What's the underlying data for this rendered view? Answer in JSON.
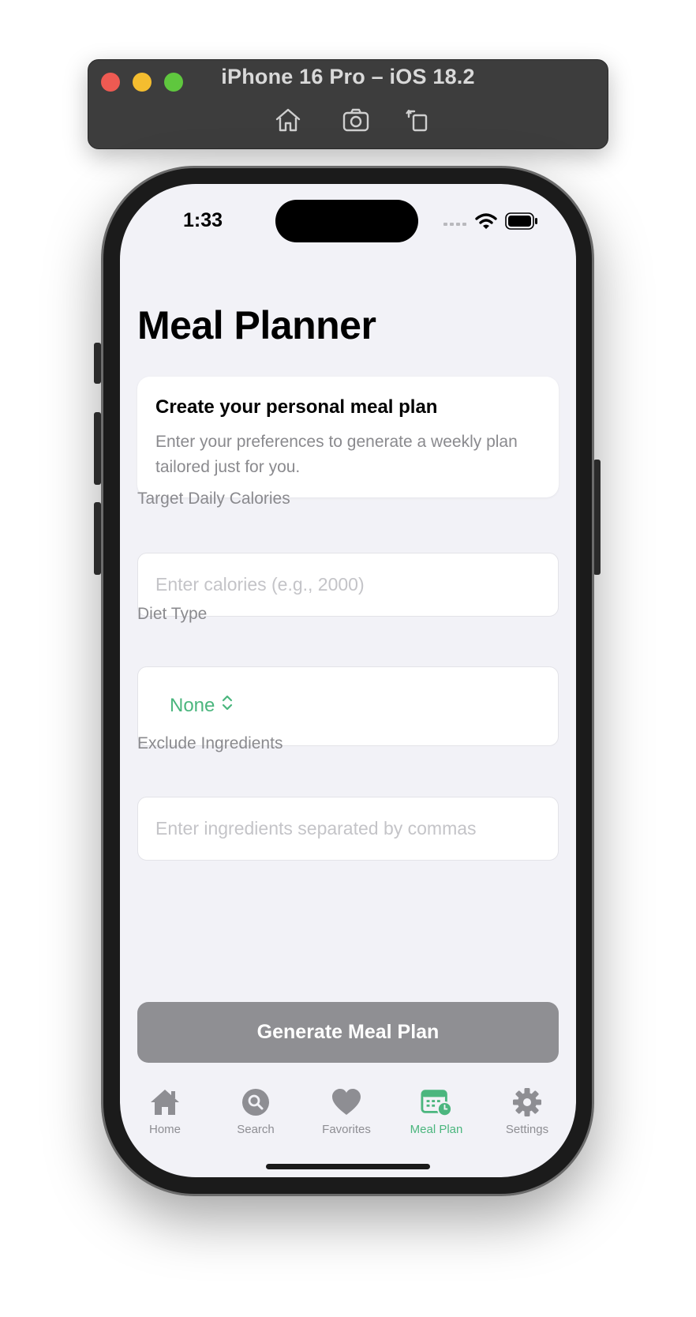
{
  "simulator": {
    "title": "iPhone 16 Pro – iOS 18.2"
  },
  "status_bar": {
    "time": "1:33"
  },
  "page": {
    "title": "Meal Planner"
  },
  "intro_card": {
    "title": "Create your personal meal plan",
    "description": "Enter your preferences to generate a weekly plan tailored just for you."
  },
  "form": {
    "calories": {
      "label": "Target Daily Calories",
      "placeholder": "Enter calories (e.g., 2000)",
      "value": ""
    },
    "diet_type": {
      "label": "Diet Type",
      "selected": "None"
    },
    "exclude": {
      "label": "Exclude Ingredients",
      "placeholder": "Enter ingredients separated by commas",
      "value": ""
    }
  },
  "generate_button": {
    "label": "Generate Meal Plan"
  },
  "tab_bar": {
    "items": [
      {
        "label": "Home",
        "icon": "house-icon"
      },
      {
        "label": "Search",
        "icon": "search-icon"
      },
      {
        "label": "Favorites",
        "icon": "heart-icon"
      },
      {
        "label": "Meal Plan",
        "icon": "calendar-clock-icon",
        "active": true
      },
      {
        "label": "Settings",
        "icon": "gear-icon"
      }
    ]
  },
  "colors": {
    "accent": "#4bb67e",
    "disabled_button": "#8f8f93",
    "background": "#f2f2f7"
  }
}
